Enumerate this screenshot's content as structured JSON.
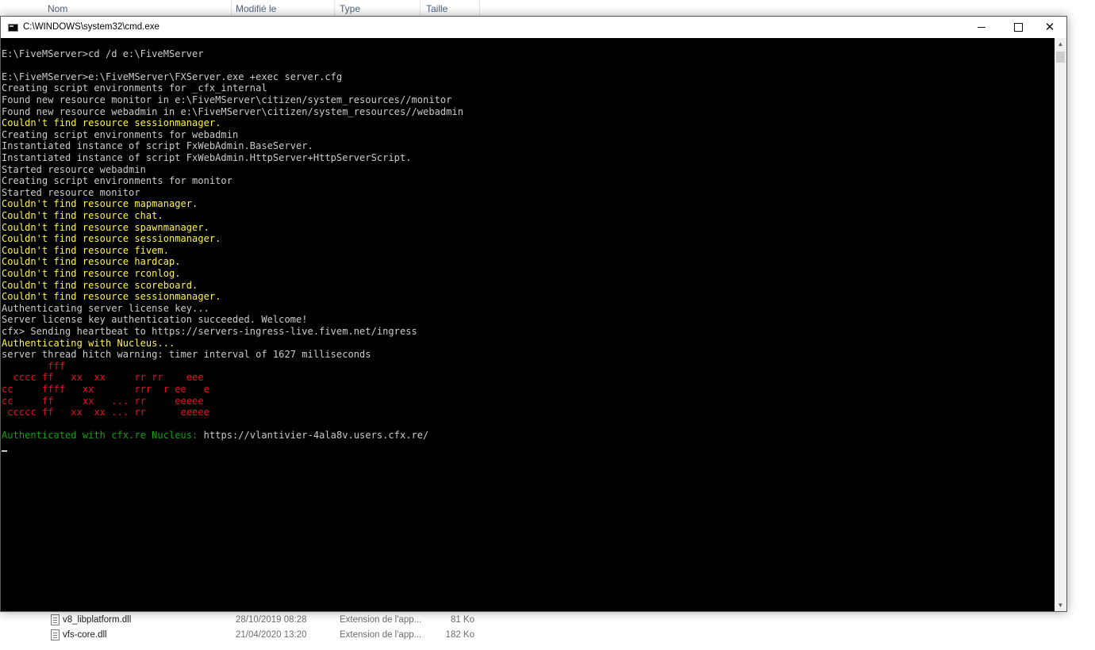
{
  "explorer": {
    "columns": [
      "Nom",
      "Modifié le",
      "Type",
      "Taille"
    ],
    "files": [
      {
        "name": "v8_libplatform.dll",
        "date": "28/10/2019 08:28",
        "type": "Extension de l'app...",
        "size": "81 Ko"
      },
      {
        "name": "vfs-core.dll",
        "date": "21/04/2020 13:20",
        "type": "Extension de l'app...",
        "size": "182 Ko"
      }
    ]
  },
  "window": {
    "title": "C:\\WINDOWS\\system32\\cmd.exe",
    "minimize_icon": "minimize-icon",
    "maximize_icon": "maximize-icon",
    "close_label": "✕"
  },
  "console": {
    "lines": [
      {
        "text": "",
        "color": "gray"
      },
      {
        "text": "E:\\FiveMServer>cd /d e:\\FiveMServer",
        "color": "gray"
      },
      {
        "text": "",
        "color": "gray"
      },
      {
        "text": "E:\\FiveMServer>e:\\FiveMServer\\FXServer.exe +exec server.cfg",
        "color": "gray"
      },
      {
        "text": "Creating script environments for _cfx_internal",
        "color": "gray"
      },
      {
        "text": "Found new resource monitor in e:\\FiveMServer\\citizen/system_resources//monitor",
        "color": "gray"
      },
      {
        "text": "Found new resource webadmin in e:\\FiveMServer\\citizen/system_resources//webadmin",
        "color": "gray"
      },
      {
        "text": "Couldn't find resource sessionmanager.",
        "color": "yellow"
      },
      {
        "text": "Creating script environments for webadmin",
        "color": "gray"
      },
      {
        "text": "Instantiated instance of script FxWebAdmin.BaseServer.",
        "color": "gray"
      },
      {
        "text": "Instantiated instance of script FxWebAdmin.HttpServer+HttpServerScript.",
        "color": "gray"
      },
      {
        "text": "Started resource webadmin",
        "color": "gray"
      },
      {
        "text": "Creating script environments for monitor",
        "color": "gray"
      },
      {
        "text": "Started resource monitor",
        "color": "gray"
      },
      {
        "text": "Couldn't find resource mapmanager.",
        "color": "yellow"
      },
      {
        "text": "Couldn't find resource chat.",
        "color": "yellow"
      },
      {
        "text": "Couldn't find resource spawnmanager.",
        "color": "yellow"
      },
      {
        "text": "Couldn't find resource sessionmanager.",
        "color": "yellow"
      },
      {
        "text": "Couldn't find resource fivem.",
        "color": "yellow"
      },
      {
        "text": "Couldn't find resource hardcap.",
        "color": "yellow"
      },
      {
        "text": "Couldn't find resource rconlog.",
        "color": "yellow"
      },
      {
        "text": "Couldn't find resource scoreboard.",
        "color": "yellow"
      },
      {
        "text": "Couldn't find resource sessionmanager.",
        "color": "yellow"
      },
      {
        "text": "Authenticating server license key...",
        "color": "gray"
      },
      {
        "text": "Server license key authentication succeeded. Welcome!",
        "color": "gray"
      },
      {
        "text": "cfx> Sending heartbeat to https://servers-ingress-live.fivem.net/ingress",
        "color": "gray"
      },
      {
        "text": "Authenticating with Nucleus...",
        "color": "yellow"
      },
      {
        "text": "server thread hitch warning: timer interval of 1627 milliseconds",
        "color": "gray"
      },
      {
        "text": "        fff",
        "color": "red"
      },
      {
        "text": "  cccc ff   xx  xx     rr rr    eee",
        "color": "red"
      },
      {
        "text": "cc     ffff   xx       rrr  r ee   e",
        "color": "red"
      },
      {
        "text": "cc     ff     xx   ... rr     eeeee",
        "color": "red"
      },
      {
        "text": " ccccc ff   xx  xx ... rr      eeeee",
        "color": "red"
      },
      {
        "text": "",
        "color": "gray"
      },
      {
        "text": "Authenticated with cfx.re Nucleus: ",
        "color": "green",
        "suffix": "https://vlantivier-4ala8v.users.cfx.re/"
      }
    ]
  },
  "colors": {
    "gray": "#cccccc",
    "yellow": "#f9f1a5",
    "red": "#e81123",
    "green": "#13a10e"
  }
}
